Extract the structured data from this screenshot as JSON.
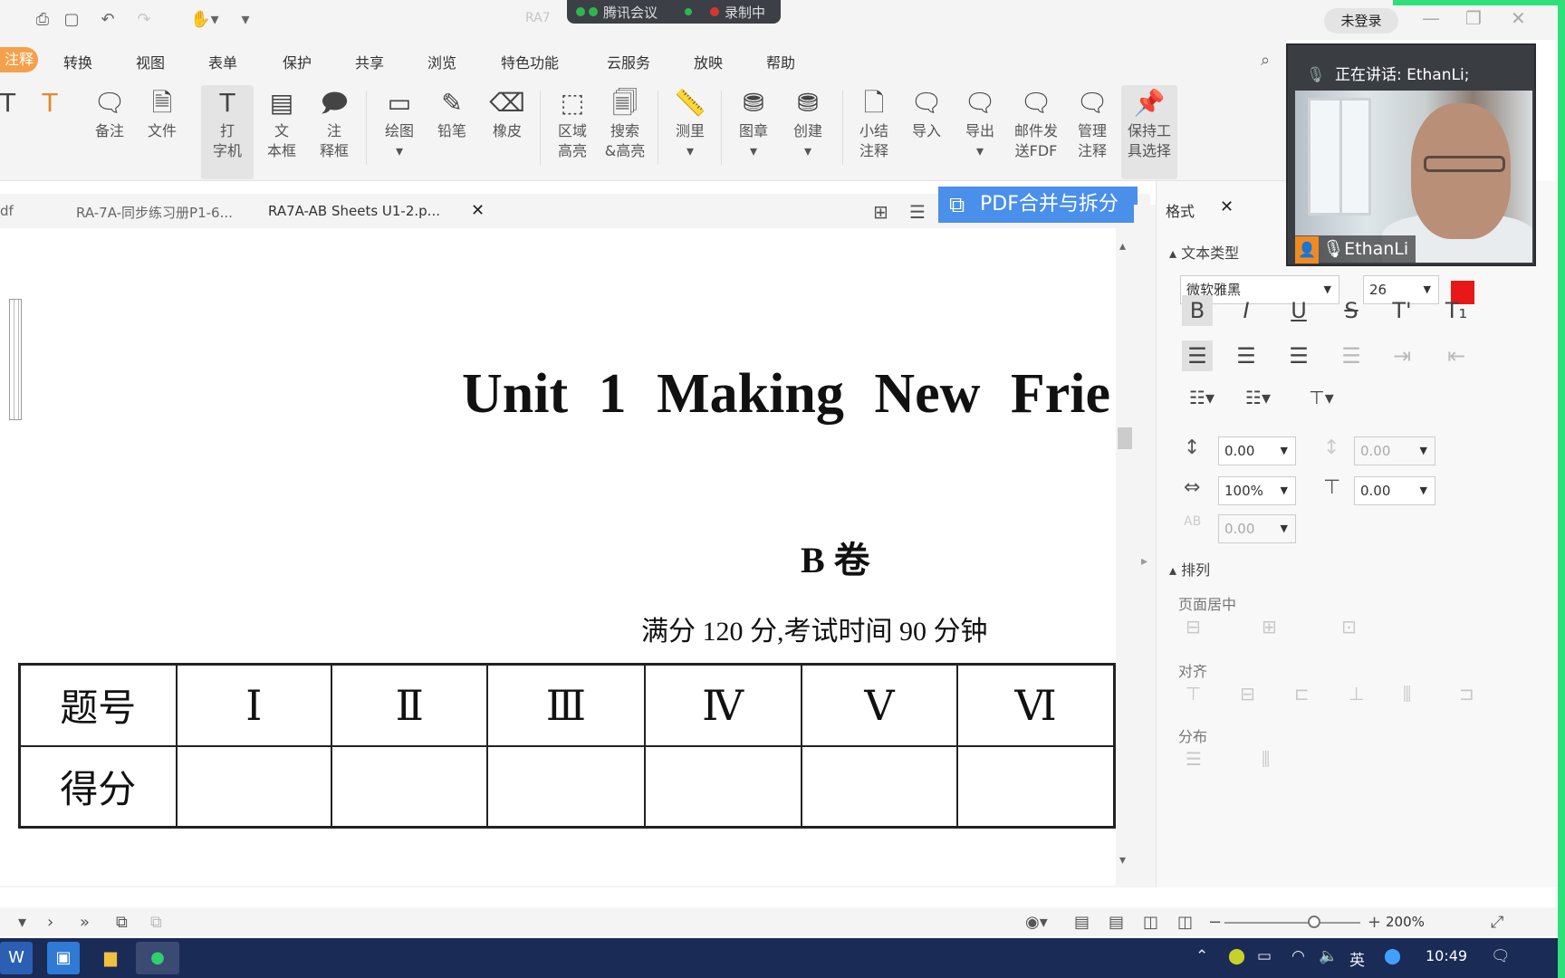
{
  "titlebar": {
    "doc_title": "RA7",
    "meeting_app": "腾讯会议",
    "recording": "录制中",
    "login": "未登录"
  },
  "menu": {
    "active": "注释",
    "items": [
      "转换",
      "视图",
      "表单",
      "保护",
      "共享",
      "浏览",
      "特色功能",
      "云服务",
      "放映",
      "帮助"
    ]
  },
  "ribbon": {
    "note": "备注",
    "file": "文件",
    "typewriter": [
      "打",
      "字机"
    ],
    "textbox": [
      "文",
      "本框"
    ],
    "callout": [
      "注",
      "释框"
    ],
    "draw": "绘图",
    "pencil": "铅笔",
    "eraser": "橡皮",
    "area_highlight": [
      "区域",
      "高亮"
    ],
    "search_highlight": [
      "搜索",
      "&高亮"
    ],
    "measure": "测里",
    "stamp": "图章",
    "create": "创建",
    "summary": [
      "小结",
      "注释"
    ],
    "import": "导入",
    "export": "导出",
    "email": [
      "邮件发",
      "送FDF"
    ],
    "manage": [
      "管理",
      "注释"
    ],
    "keep_tool": [
      "保持工",
      "具选择"
    ]
  },
  "tabs": {
    "first": "df",
    "second": "RA-7A-同步练习册P1-6...",
    "active": "RA7A-AB Sheets U1-2.p...",
    "pdf_merge": "PDF合并与拆分"
  },
  "document": {
    "unit_title": "Unit 1   Making New Frie",
    "section": "B 卷",
    "exam_info": "满分 120 分,考试时间 90 分钟",
    "table": {
      "row1_label": "题号",
      "row2_label": "得分",
      "numerals": [
        "Ⅰ",
        "Ⅱ",
        "Ⅲ",
        "Ⅳ",
        "Ⅴ",
        "Ⅵ"
      ]
    }
  },
  "format_panel": {
    "tab": "格式",
    "text_type_section": "文本类型",
    "font": "微软雅黑",
    "font_size": "26",
    "text_color": "#e81818",
    "line_spacing": "0.00",
    "para_spacing": "0.00",
    "scale": "100%",
    "baseline": "0.00",
    "char_spacing": "0.00",
    "arrange_section": "排列",
    "page_center": "页面居中",
    "align": "对齐",
    "distribute": "分布"
  },
  "video": {
    "speaking": "正在讲话: EthanLi;",
    "name": "EthanLi"
  },
  "statusbar": {
    "zoom": "200%"
  },
  "taskbar": {
    "ime": "英",
    "time": "10:49"
  }
}
